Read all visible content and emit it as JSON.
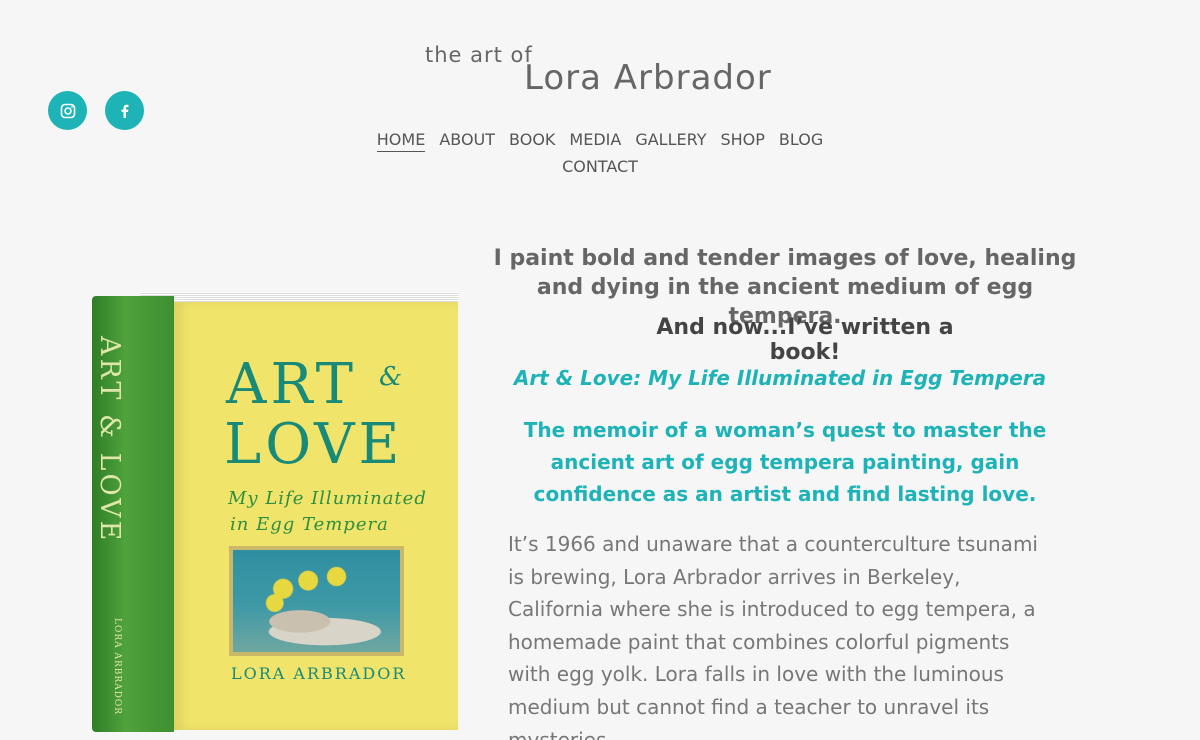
{
  "header": {
    "logo_small": "the art of",
    "logo_big": "Lora Arbrador",
    "social": [
      {
        "icon": "instagram-icon"
      },
      {
        "icon": "facebook-icon"
      }
    ]
  },
  "nav": {
    "items": [
      {
        "label": "HOME",
        "active": true
      },
      {
        "label": "ABOUT"
      },
      {
        "label": "BOOK"
      },
      {
        "label": "MEDIA"
      },
      {
        "label": "GALLERY"
      },
      {
        "label": "SHOP"
      },
      {
        "label": "BLOG"
      },
      {
        "label": "CONTACT"
      }
    ]
  },
  "book_cover": {
    "title_line1": "ART",
    "ampersand": "&",
    "title_line2": "LOVE",
    "subtitle_line1": "My Life Illuminated",
    "subtitle_line2": "in Egg Tempera",
    "author": "LORA ARBRADOR",
    "spine_title": "ART & LOVE",
    "spine_author": "LORA ARBRADOR"
  },
  "main": {
    "headline": "I paint bold and tender images of love, healing and dying in the ancient medium of egg tempera.",
    "subhead": "And now...I’ve written a book!",
    "book_title": "Art & Love: My Life Illuminated in Egg Tempera",
    "tagline": "The  memoir of a woman’s quest to master the ancient art of egg tempera painting, gain confidence as an artist and find lasting love.",
    "body": "It’s 1966 and unaware that a counterculture tsunami is brewing, Lora Arbrador arrives in Berkeley, California where she is introduced to egg tempera, a homemade paint that combines colorful pigments with egg yolk. Lora falls in love with the luminous medium but cannot find a teacher to unravel its mysteries."
  },
  "colors": {
    "accent": "#1eb3b7",
    "background": "#f6f6f6",
    "text": "#666666"
  }
}
